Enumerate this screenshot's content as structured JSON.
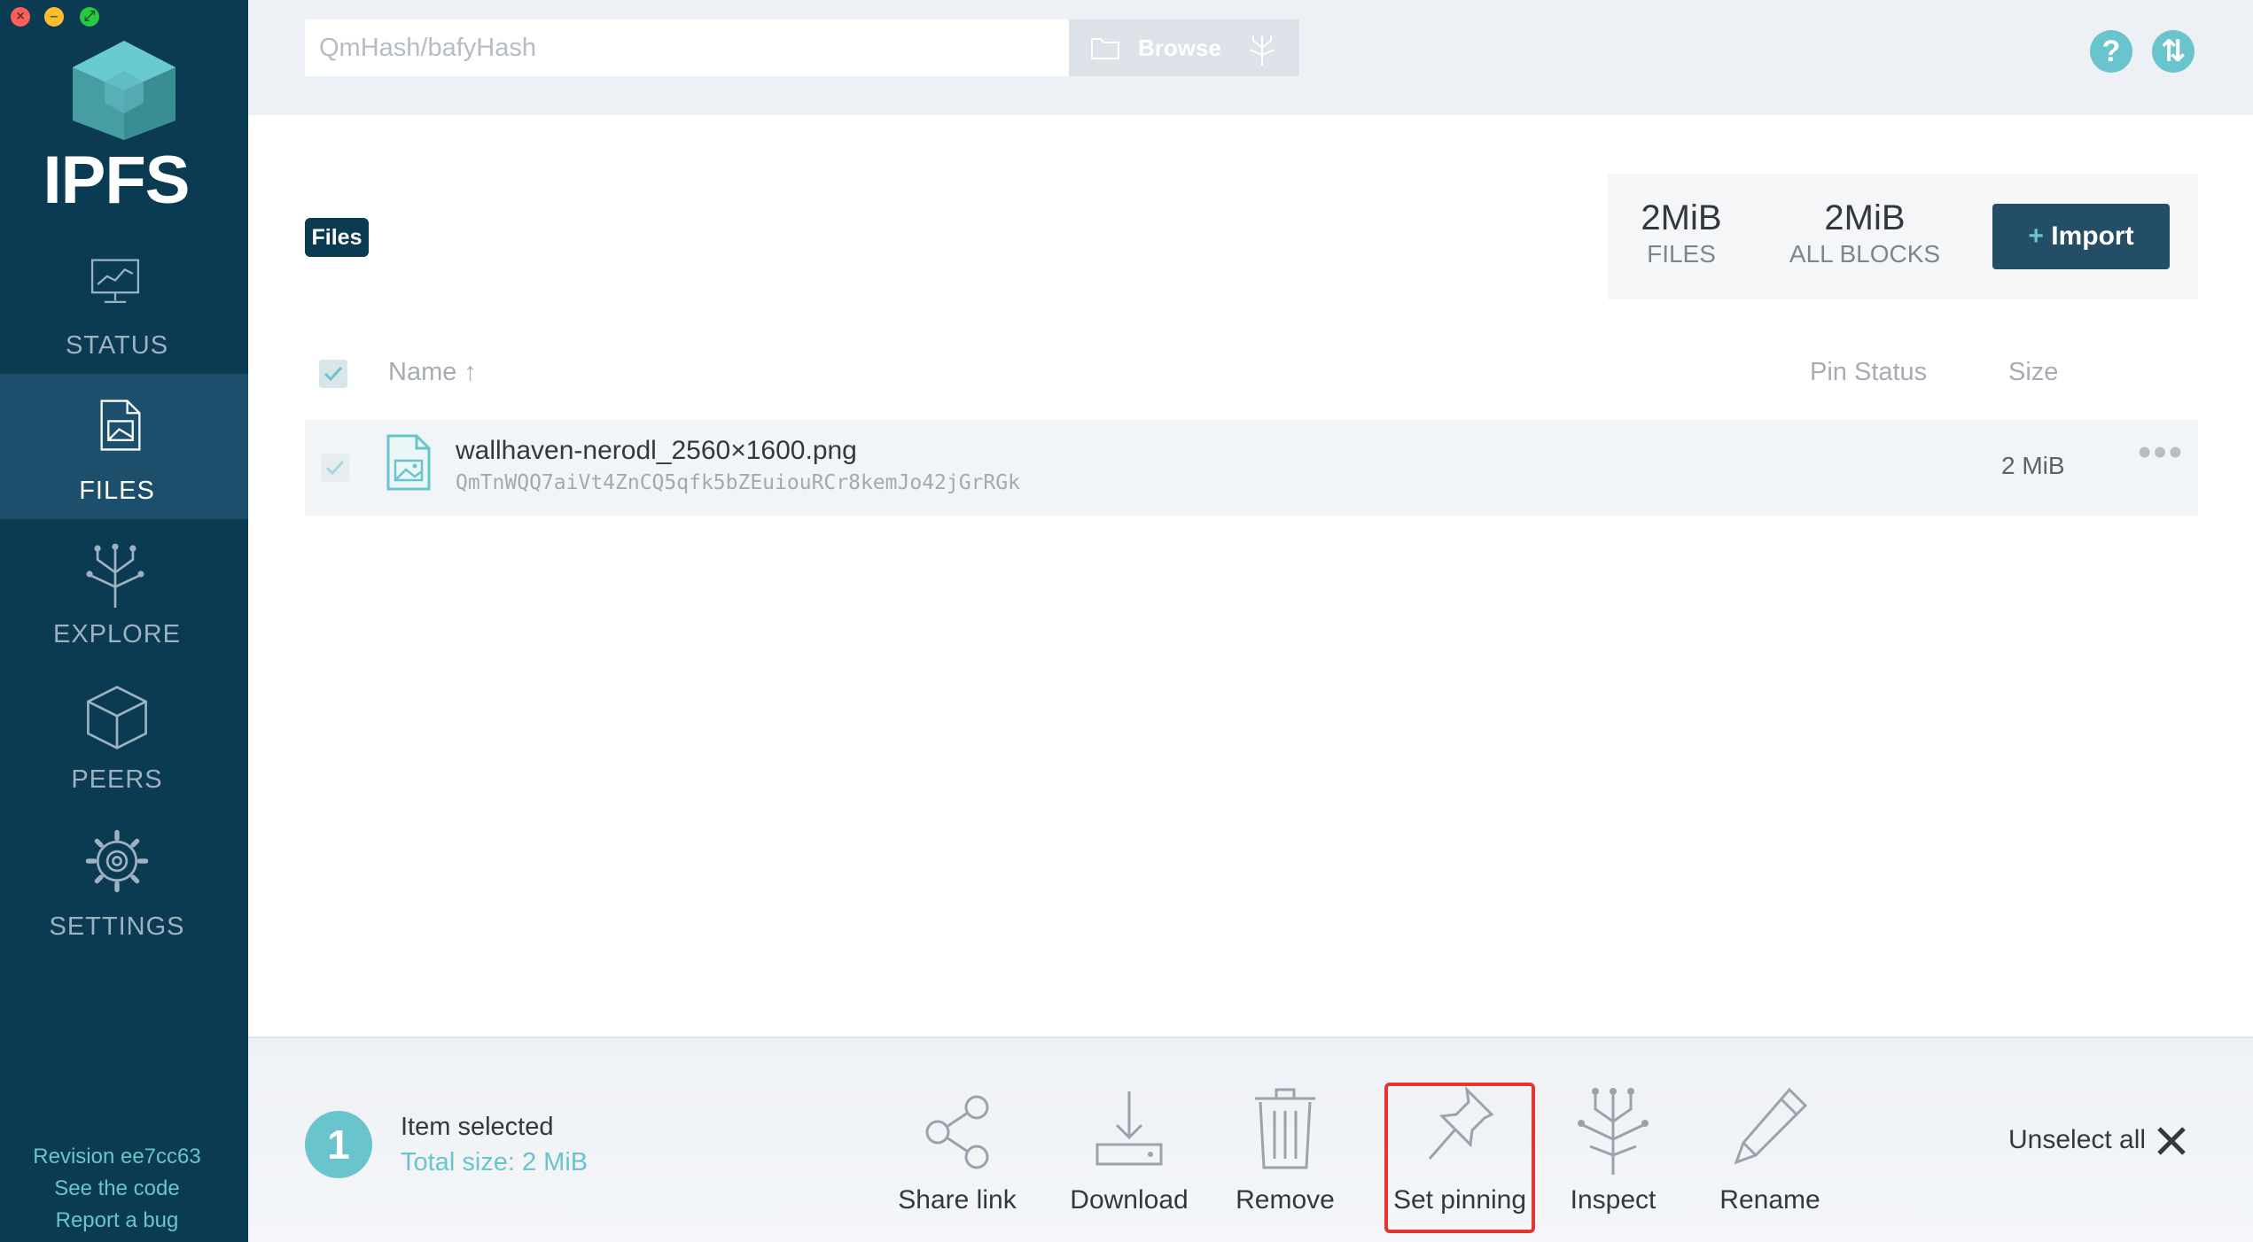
{
  "window": {
    "app_name": "IPFS"
  },
  "sidebar": {
    "brand": "IPFS",
    "items": [
      {
        "label": "STATUS",
        "icon": "status-monitor-icon"
      },
      {
        "label": "FILES",
        "icon": "files-icon",
        "active": true
      },
      {
        "label": "EXPLORE",
        "icon": "explore-tree-icon"
      },
      {
        "label": "PEERS",
        "icon": "peers-cube-icon"
      },
      {
        "label": "SETTINGS",
        "icon": "settings-gear-icon"
      }
    ],
    "footer": {
      "revision": "Revision ee7cc63",
      "see_code": "See the code",
      "report_bug": "Report a bug"
    }
  },
  "header": {
    "search_placeholder": "QmHash/bafyHash",
    "browse_label": "Browse"
  },
  "files": {
    "breadcrumb": "Files",
    "stats": {
      "files_value": "2MiB",
      "files_label": "FILES",
      "blocks_value": "2MiB",
      "blocks_label": "ALL BLOCKS"
    },
    "import_label": "Import",
    "import_plus": "+",
    "columns": {
      "name": "Name ↑",
      "pin_status": "Pin Status",
      "size": "Size"
    },
    "rows": [
      {
        "name": "wallhaven-nerodl_2560×1600.png",
        "hash": "QmTnWQQ7aiVt4ZnCQ5qfk5bZEuiouRCr8kemJo42jGrRGk",
        "size": "2 MiB",
        "selected": true
      }
    ]
  },
  "selection_bar": {
    "count": "1",
    "selected_text": "Item selected",
    "total_size": "Total size: 2 MiB",
    "actions": {
      "share": "Share link",
      "download": "Download",
      "remove": "Remove",
      "pin": "Set pinning",
      "inspect": "Inspect",
      "rename": "Rename"
    },
    "unselect_all": "Unselect all"
  },
  "colors": {
    "sidebar_bg": "#0b3a53",
    "sidebar_active": "#1b4f6c",
    "accent_teal": "#69c4cd",
    "import_btn": "#244e66",
    "highlight_box": "#e2362e"
  }
}
